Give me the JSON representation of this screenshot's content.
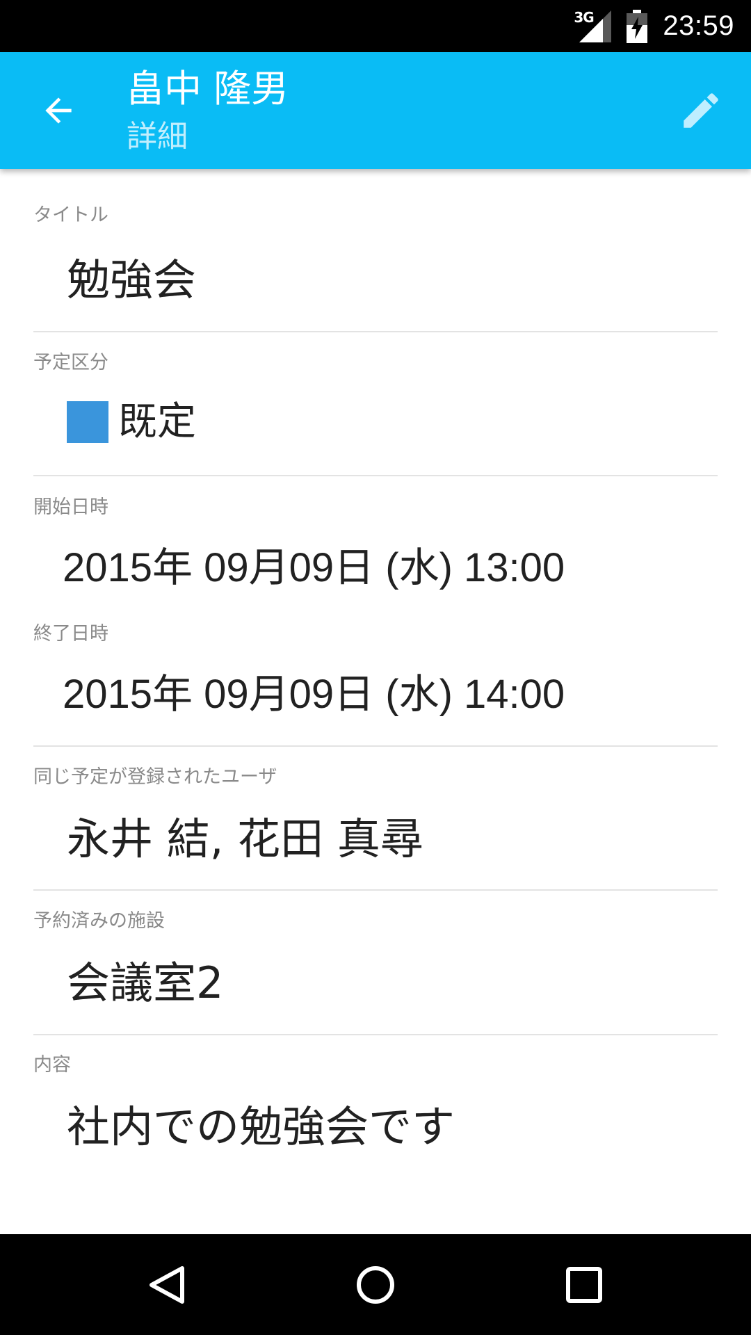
{
  "status_bar": {
    "network": "3G",
    "time": "23:59",
    "icons": [
      "signal-icon",
      "battery-charging-icon"
    ]
  },
  "app_bar": {
    "title": "畠中 隆男",
    "subtitle": "詳細",
    "background_color": "#0abcf5",
    "icons": [
      "back-arrow-icon",
      "edit-pencil-icon"
    ]
  },
  "details": {
    "title": {
      "label": "タイトル",
      "value": "勉強会"
    },
    "category": {
      "label": "予定区分",
      "value": "既定",
      "color": "#3a95dc"
    },
    "start": {
      "label": "開始日時",
      "value": "2015年 09月09日 (水)  13:00"
    },
    "end": {
      "label": "終了日時",
      "value": "2015年 09月09日 (水)  14:00"
    },
    "users": {
      "label": "同じ予定が登録されたユーザ",
      "value": "永井 結,  花田 真尋"
    },
    "facility": {
      "label": "予約済みの施設",
      "value": "会議室2"
    },
    "content": {
      "label": "内容",
      "value": "社内での勉強会です"
    }
  },
  "nav_bar": {
    "icons": [
      "nav-back-icon",
      "nav-home-icon",
      "nav-recents-icon"
    ]
  }
}
